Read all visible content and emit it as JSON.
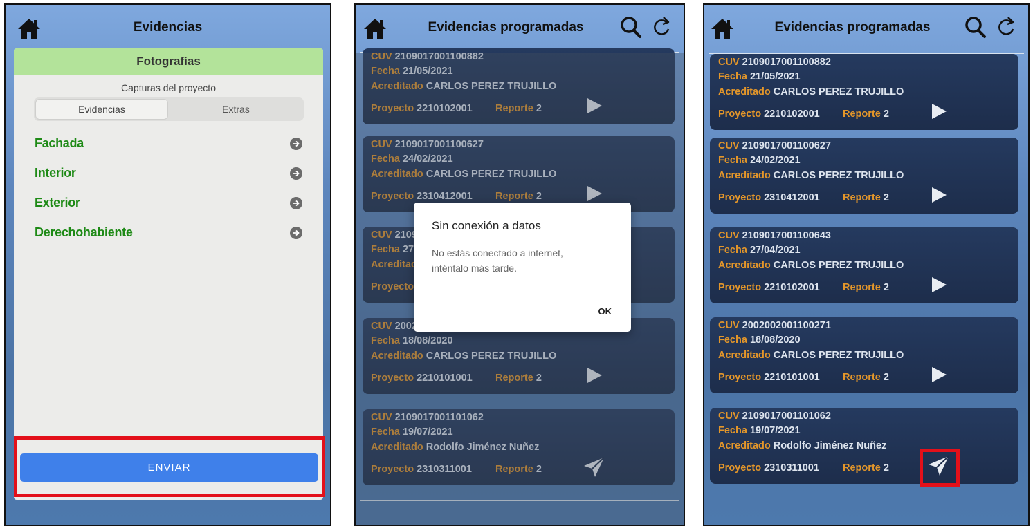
{
  "panel1": {
    "title": "Evidencias",
    "section": "Fotografías",
    "caption": "Capturas del proyecto",
    "tabs": [
      "Evidencias",
      "Extras"
    ],
    "categories": [
      "Fachada",
      "Interior",
      "Exterior",
      "Derechohabiente"
    ],
    "send_label": "ENVIAR"
  },
  "panel2": {
    "title": "Evidencias programadas",
    "items": [
      {
        "cuv": "2109017001100882",
        "fecha": "21/05/2021",
        "acreditado": "CARLOS PEREZ TRUJILLO",
        "proyecto": "2210102001",
        "reporte": "2",
        "action": "play"
      },
      {
        "cuv": "2109017001100627",
        "fecha": "24/02/2021",
        "acreditado": "CARLOS PEREZ TRUJILLO",
        "proyecto": "2310412001",
        "reporte": "2",
        "action": "play"
      },
      {
        "cuv": "2109017001100643",
        "fecha": "27/04/2021",
        "acreditado": "CARLOS PEREZ TRUJILLO",
        "proyecto": "2210102001",
        "reporte": "2",
        "action": "play"
      },
      {
        "cuv": "2002002001100271",
        "fecha": "18/08/2020",
        "acreditado": "CARLOS PEREZ TRUJILLO",
        "proyecto": "2210101001",
        "reporte": "2",
        "action": "play"
      },
      {
        "cuv": "2109017001101062",
        "fecha": "19/07/2021",
        "acreditado": "Rodolfo Jiménez Nuñez",
        "proyecto": "2310311001",
        "reporte": "2",
        "action": "send"
      }
    ],
    "dialog": {
      "title": "Sin conexión a datos",
      "message": "No estás conectado a internet, inténtalo más tarde.",
      "ok": "OK"
    }
  },
  "panel3": {
    "title": "Evidencias programadas"
  },
  "labels": {
    "cuv": "CUV",
    "fecha": "Fecha",
    "acreditado": "Acreditado",
    "proyecto": "Proyecto",
    "reporte": "Reporte"
  },
  "icons": {
    "home": "home-icon",
    "search": "search-icon",
    "refresh": "refresh-icon",
    "arrow": "arrow-right-circle-icon",
    "play": "play-icon",
    "send": "send-plane-icon"
  },
  "colors": {
    "label_orange": "#e3962a",
    "value_light": "#dde4ee",
    "category_green": "#1e8a16",
    "section_green": "#b3e39a",
    "send_blue": "#3f80ea",
    "highlight_red": "#e3101a"
  }
}
